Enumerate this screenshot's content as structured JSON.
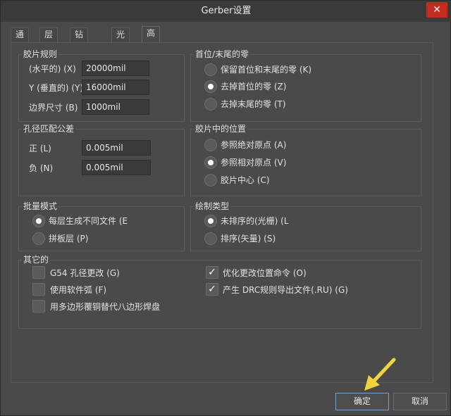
{
  "window": {
    "title": "Gerber设置",
    "close_glyph": "✕"
  },
  "tabs": [
    {
      "label": "通用"
    },
    {
      "label": "层"
    },
    {
      "label": "钻孔图层"
    },
    {
      "label": "光圈"
    },
    {
      "label": "高级"
    }
  ],
  "film": {
    "title": "胶片规则",
    "x_label": "(水平的) (X)",
    "x_value": "20000mil",
    "y_label": "Y (垂直的) (Y)",
    "y_value": "16000mil",
    "border_label": "边界尺寸 (B)",
    "border_value": "1000mil"
  },
  "zeros": {
    "title": "首位/末尾的零",
    "options": [
      "保留首位和末尾的零 (K)",
      "去掉首位的零 (Z)",
      "去掉末尾的零 (T)"
    ],
    "selected": 1
  },
  "hole": {
    "title": "孔径匹配公差",
    "plus_label": "正 (L)",
    "plus_value": "0.005mil",
    "minus_label": "负 (N)",
    "minus_value": "0.005mil"
  },
  "position": {
    "title": "胶片中的位置",
    "options": [
      "参照绝对原点 (A)",
      "参照相对原点 (V)",
      "胶片中心 (C)"
    ],
    "selected": 1
  },
  "batch": {
    "title": "批量模式",
    "options": [
      "每层生成不同文件 (E",
      "拼板层 (P)"
    ],
    "selected": 0
  },
  "plot": {
    "title": "绘制类型",
    "options": [
      "未排序的(光栅) (L",
      "排序(矢量) (S)"
    ],
    "selected": 0
  },
  "other": {
    "title": "其它的",
    "left": [
      {
        "label": "G54 孔径更改 (G)",
        "checked": false
      },
      {
        "label": "使用软件弧 (F)",
        "checked": false
      },
      {
        "label": "用多边形覆铜替代八边形焊盘",
        "checked": false
      }
    ],
    "right": [
      {
        "label": "优化更改位置命令 (O)",
        "checked": true
      },
      {
        "label": "产生 DRC规则导出文件(.RU) (G)",
        "checked": true
      }
    ]
  },
  "buttons": {
    "ok": "确定",
    "cancel": "取消"
  },
  "colors": {
    "annotation_arrow": "#f2d43a",
    "close_button": "#c42b1c",
    "primary_border": "#7aa0d0"
  },
  "icons": {
    "close": "close-icon",
    "check": "checkmark-icon",
    "annotation": "arrow-annotation-icon"
  }
}
